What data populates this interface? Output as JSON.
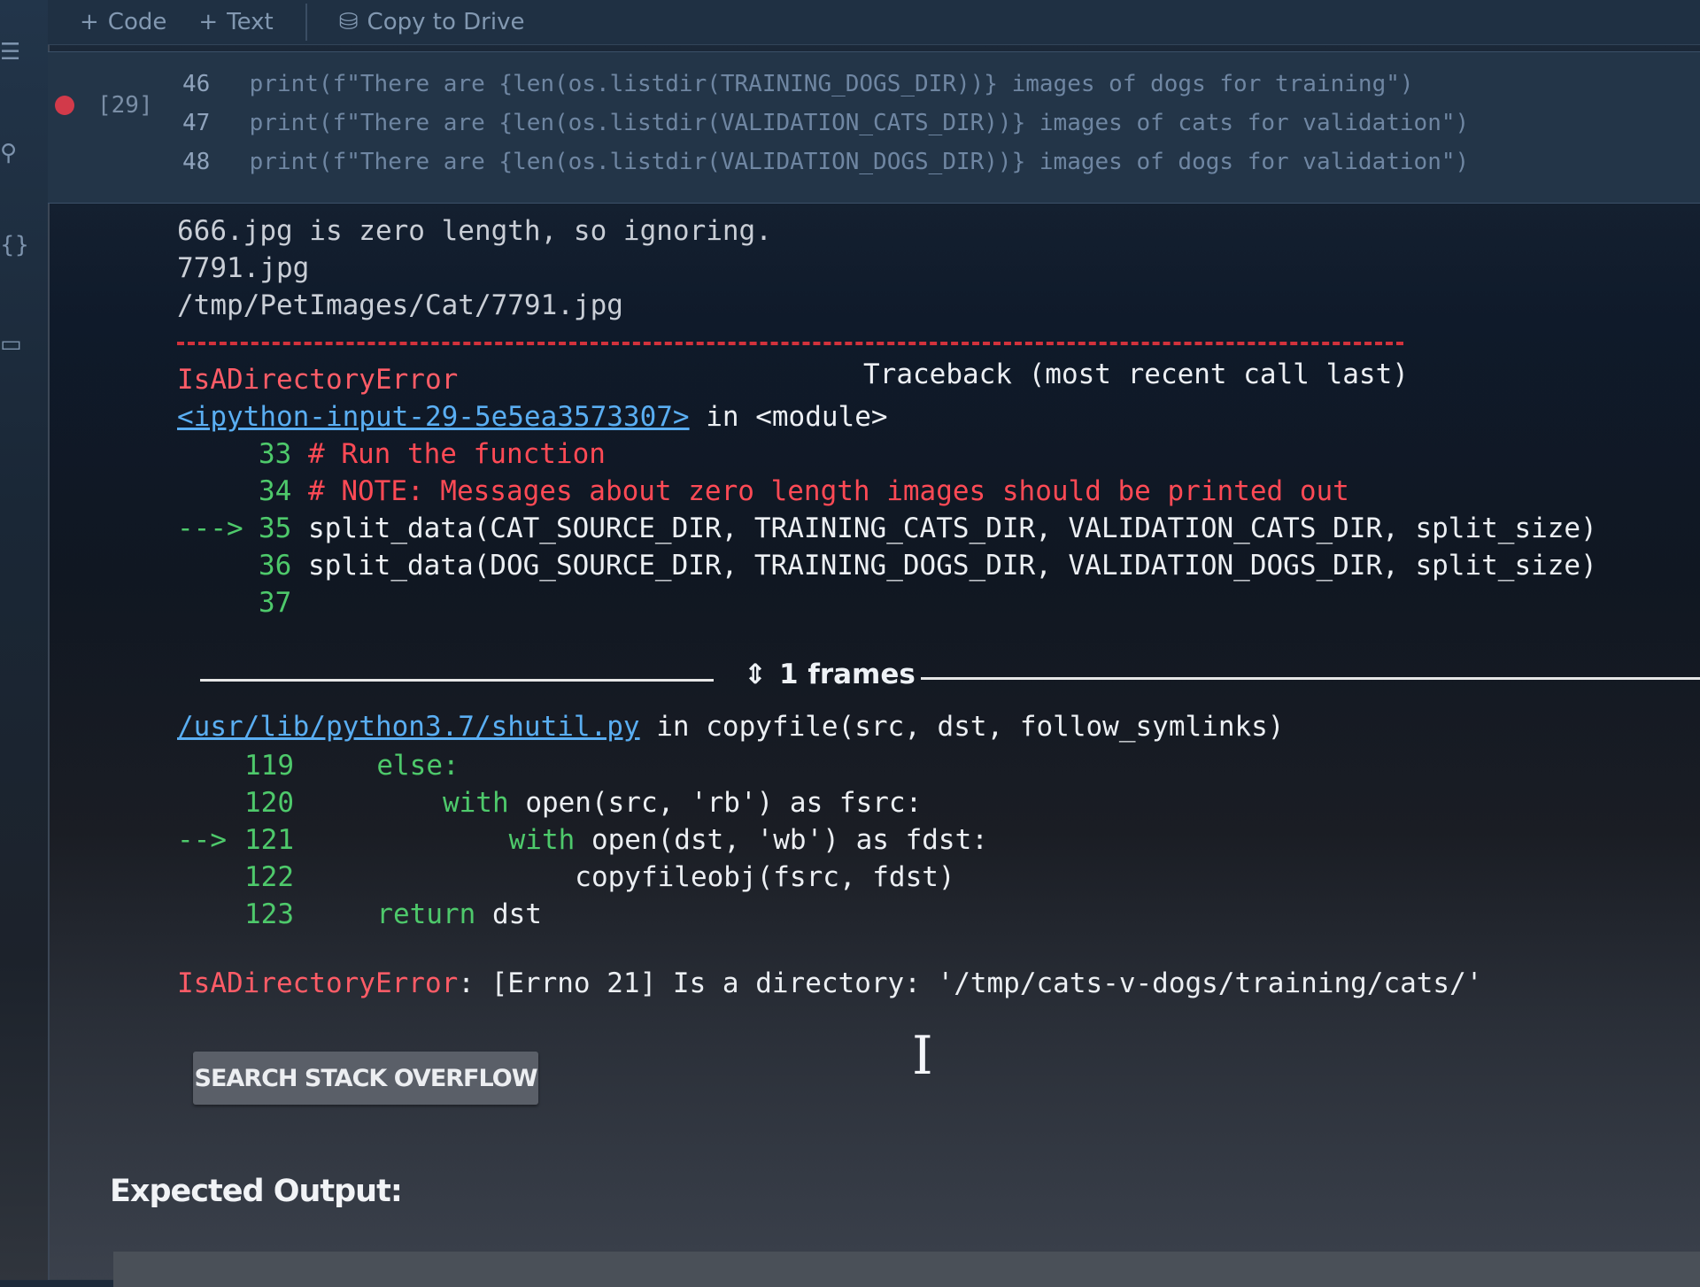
{
  "toolbar": {
    "code_label": "Code",
    "text_label": "Text",
    "drive_label": "Copy to Drive"
  },
  "cell": {
    "exec_count": "[29]",
    "lines": [
      {
        "num": "46",
        "code": "print(f\"There are {len(os.listdir(TRAINING_DOGS_DIR))} images of dogs for training\")"
      },
      {
        "num": "47",
        "code": "print(f\"There are {len(os.listdir(VALIDATION_CATS_DIR))} images of cats for validation\")"
      },
      {
        "num": "48",
        "code": "print(f\"There are {len(os.listdir(VALIDATION_DOGS_DIR))} images of dogs for validation\")"
      }
    ]
  },
  "output": {
    "line1": "666.jpg is zero length, so ignoring.",
    "line2": "7791.jpg",
    "line3": "/tmp/PetImages/Cat/7791.jpg",
    "error_name": "IsADirectoryError",
    "traceback_header": "Traceback (most recent call last)",
    "input_link": "<ipython-input-29-5e5ea3573307>",
    "in_module": " in <module>",
    "tb1": [
      {
        "arrow": "",
        "num": "33",
        "text": "# Run the function",
        "kind": "comment"
      },
      {
        "arrow": "",
        "num": "34",
        "text": "# NOTE: Messages about zero length images should be printed out",
        "kind": "comment"
      },
      {
        "arrow": "--->",
        "num": "35",
        "text": "split_data(CAT_SOURCE_DIR, TRAINING_CATS_DIR, VALIDATION_CATS_DIR, split_size)",
        "kind": "code"
      },
      {
        "arrow": "",
        "num": "36",
        "text": "split_data(DOG_SOURCE_DIR, TRAINING_DOGS_DIR, VALIDATION_DOGS_DIR, split_size)",
        "kind": "code"
      },
      {
        "arrow": "",
        "num": "37",
        "text": "",
        "kind": "code"
      }
    ],
    "frames_label": "1 frames",
    "shutil_link": "/usr/lib/python3.7/shutil.py",
    "shutil_in": " in copyfile(src, dst, follow_symlinks)",
    "tb2": [
      {
        "arrow": "",
        "num": "119",
        "indent": "    ",
        "kw": "else:",
        "rest": ""
      },
      {
        "arrow": "",
        "num": "120",
        "indent": "        ",
        "kw": "with ",
        "rest": "open(src, 'rb') as fsrc:"
      },
      {
        "arrow": "-->",
        "num": "121",
        "indent": "            ",
        "kw": "with ",
        "rest": "open(dst, 'wb') as fdst:"
      },
      {
        "arrow": "",
        "num": "122",
        "indent": "                ",
        "kw": "",
        "rest": "copyfileobj(fsrc, fdst)"
      },
      {
        "arrow": "",
        "num": "123",
        "indent": "    ",
        "kw": "return ",
        "rest": "dst"
      }
    ],
    "final_error_name": "IsADirectoryError",
    "final_error_msg": ": [Errno 21] Is a directory: '/tmp/cats-v-dogs/training/cats/'"
  },
  "so_button": "SEARCH STACK OVERFLOW",
  "expected_label": "Expected Output:",
  "icons": [
    "plus-icon",
    "drive-icon",
    "menu-icon",
    "search-icon",
    "code-brackets-icon",
    "folder-icon",
    "collapse-arrows-icon",
    "text-cursor-icon"
  ]
}
